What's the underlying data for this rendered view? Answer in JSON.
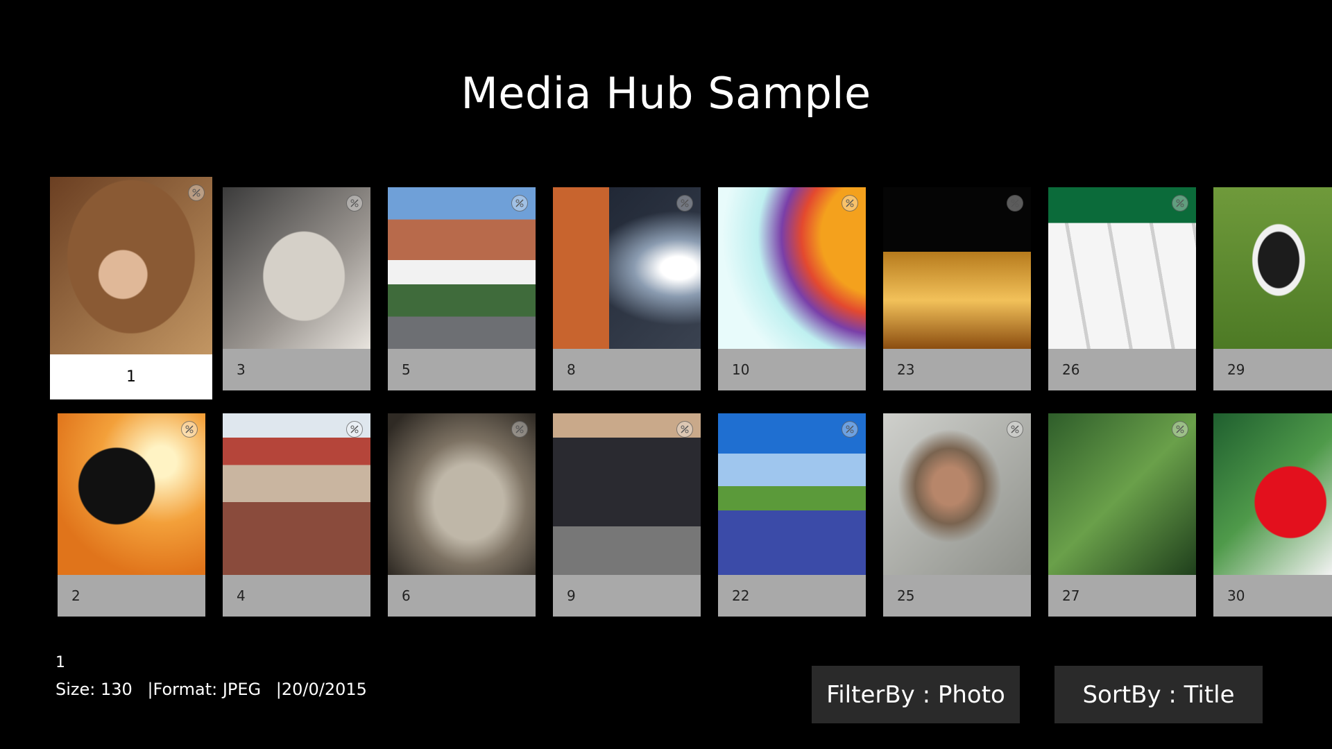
{
  "header": {
    "title": "Media Hub Sample"
  },
  "grid": {
    "row1": [
      {
        "label": "1",
        "focused": true
      },
      {
        "label": "3"
      },
      {
        "label": "5"
      },
      {
        "label": "8"
      },
      {
        "label": "10"
      },
      {
        "label": "23"
      },
      {
        "label": "26"
      },
      {
        "label": "29"
      }
    ],
    "row2": [
      {
        "label": "2"
      },
      {
        "label": "4"
      },
      {
        "label": "6"
      },
      {
        "label": "9"
      },
      {
        "label": "22"
      },
      {
        "label": "25"
      },
      {
        "label": "27"
      },
      {
        "label": "30"
      }
    ]
  },
  "details": {
    "name": "1",
    "size": "Size: 130",
    "format": "|Format: JPEG",
    "date": "|20/0/2015"
  },
  "controls": {
    "filter_label": "FilterBy : Photo",
    "sort_label": "SortBy : Title"
  },
  "colors": {
    "background": "#000000",
    "tile_caption_bg": "#a9a9a9",
    "focused_bg": "#ffffff",
    "button_bg": "#2a2a2a"
  }
}
